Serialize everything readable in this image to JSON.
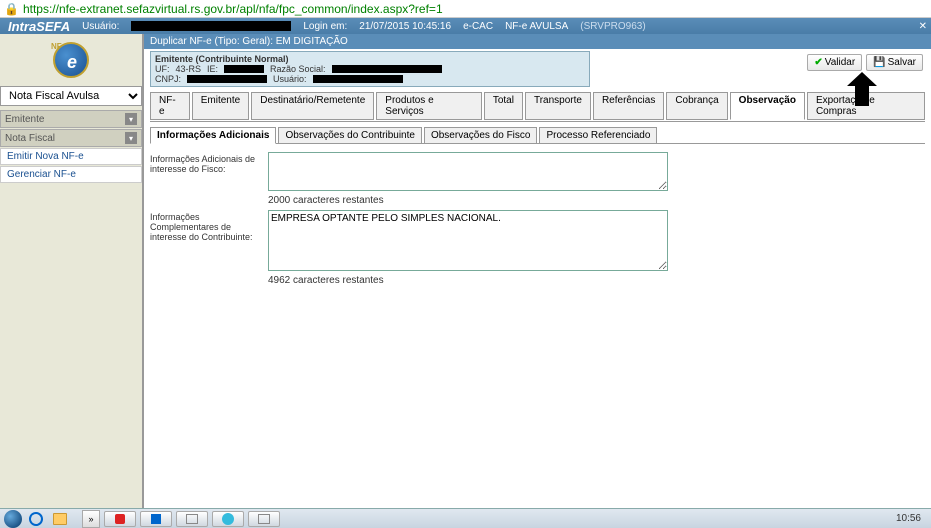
{
  "url": "https://nfe-extranet.sefazvirtual.rs.gov.br/apl/nfa/fpc_common/index.aspx?ref=1",
  "header": {
    "brand": "IntraSEFA",
    "usuario_label": "Usuário:",
    "login_label": "Login em:",
    "login_time": "21/07/2015 10:45:16",
    "ecac": "e-CAC",
    "nfe_avulsa": "NF-e AVULSA",
    "server": "(SRVPRO963)"
  },
  "sidebar": {
    "select_value": "Nota Fiscal Avulsa",
    "sections": [
      {
        "label": "Emitente"
      },
      {
        "label": "Nota Fiscal"
      }
    ],
    "items": [
      {
        "label": "Emitir Nova NF-e"
      },
      {
        "label": "Gerenciar NF-e"
      }
    ]
  },
  "duplicate_bar": "Duplicar NF-e (Tipo: Geral):  EM DIGITAÇÃO",
  "emitente_box": {
    "line1_a": "Emitente (Contribuinte Normal)",
    "uf_label": "UF:",
    "uf_val": "43-RS",
    "ie_label": "IE:",
    "razao_label": "Razão Social:",
    "cnpj_label": "CNPJ:",
    "usuario_label": "Usuário:"
  },
  "buttons": {
    "validar": "Validar",
    "salvar": "Salvar"
  },
  "main_tabs": [
    "NF-e",
    "Emitente",
    "Destinatário/Remetente",
    "Produtos e Serviços",
    "Total",
    "Transporte",
    "Referências",
    "Cobrança",
    "Observação",
    "Exportação e Compras"
  ],
  "main_tab_active": 8,
  "sub_tabs": [
    "Informações Adicionais",
    "Observações do Contribuinte",
    "Observações do Fisco",
    "Processo Referenciado"
  ],
  "sub_tab_active": 0,
  "form": {
    "fisco_label": "Informações Adicionais de interesse do Fisco:",
    "fisco_value": "",
    "fisco_count": "2000 caracteres restantes",
    "contrib_label": "Informações Complementares de interesse do Contribuinte:",
    "contrib_value": "EMPRESA OPTANTE PELO SIMPLES NACIONAL.",
    "contrib_count": "4962 caracteres restantes"
  },
  "taskbar": {
    "clock": "10:56"
  }
}
